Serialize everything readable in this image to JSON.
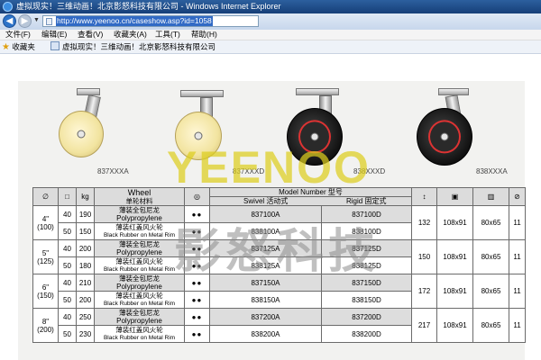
{
  "window": {
    "title": "虚拟现实！三维动画！北京影怒科技有限公司 - Windows Internet Explorer"
  },
  "address_bar": {
    "url": "http://www.yeenoo.cn/caseshow.asp?id=1058"
  },
  "menu": [
    "文件(F)",
    "编辑(E)",
    "查看(V)",
    "收藏夹(A)",
    "工具(T)",
    "帮助(H)"
  ],
  "favorites_bar": {
    "favorites_label": "收藏夹",
    "tab_title": "虚拟现实！三维动画！北京影怒科技有限公司"
  },
  "catalog": {
    "model_codes": [
      "837XXXA",
      "837XXXD",
      "838XXXD",
      "838XXXA"
    ],
    "header": {
      "wheel_en": "Wheel",
      "wheel_cn": "单轮材料",
      "model_number": "Model Number 型号",
      "swivel": "Swivel 活动式",
      "rigid": "Rigid 固定式"
    },
    "rows": [
      {
        "size": "4\"",
        "size_mm": "(100)",
        "load_a": "40",
        "load_b": "190",
        "mat_cn": "薄装全包尼龙",
        "mat_en": "Polypropylene",
        "swivel": "837100A",
        "rigid": "837100D"
      },
      {
        "load_a": "50",
        "load_b": "150",
        "mat_cn": "薄装红盖风火轮",
        "mat_en": "Black Rubber on Metal Rim",
        "swivel": "838100A",
        "rigid": "838100D",
        "h": "132",
        "plate": "108x91",
        "holes": "80x65",
        "bolt": "11"
      },
      {
        "size": "5\"",
        "size_mm": "(125)",
        "load_a": "40",
        "load_b": "200",
        "mat_cn": "薄装全包尼龙",
        "mat_en": "Polypropylene",
        "swivel": "837125A",
        "rigid": "837125D"
      },
      {
        "load_a": "50",
        "load_b": "180",
        "mat_cn": "薄装红盖风火轮",
        "mat_en": "Black Rubber on Metal Rim",
        "swivel": "838125A",
        "rigid": "838125D",
        "h": "150",
        "plate": "108x91",
        "holes": "80x65",
        "bolt": "11"
      },
      {
        "size": "6\"",
        "size_mm": "(150)",
        "load_a": "40",
        "load_b": "210",
        "mat_cn": "薄装全包尼龙",
        "mat_en": "Polypropylene",
        "swivel": "837150A",
        "rigid": "837150D"
      },
      {
        "load_a": "50",
        "load_b": "200",
        "mat_cn": "薄装红盖风火轮",
        "mat_en": "Black Rubber on Metal Rim",
        "swivel": "838150A",
        "rigid": "838150D",
        "h": "172",
        "plate": "108x91",
        "holes": "80x65",
        "bolt": "11"
      },
      {
        "size": "8\"",
        "size_mm": "(200)",
        "load_a": "40",
        "load_b": "250",
        "mat_cn": "薄装全包尼龙",
        "mat_en": "Polypropylene",
        "swivel": "837200A",
        "rigid": "837200D"
      },
      {
        "load_a": "50",
        "load_b": "230",
        "mat_cn": "薄装红盖风火轮",
        "mat_en": "Black Rubber on Metal Rim",
        "swivel": "838200A",
        "rigid": "838200D",
        "h": "217",
        "plate": "108x91",
        "holes": "80x65",
        "bolt": "11"
      }
    ],
    "watermark_en": "YEENOO",
    "watermark_cn": "影怒科技"
  }
}
